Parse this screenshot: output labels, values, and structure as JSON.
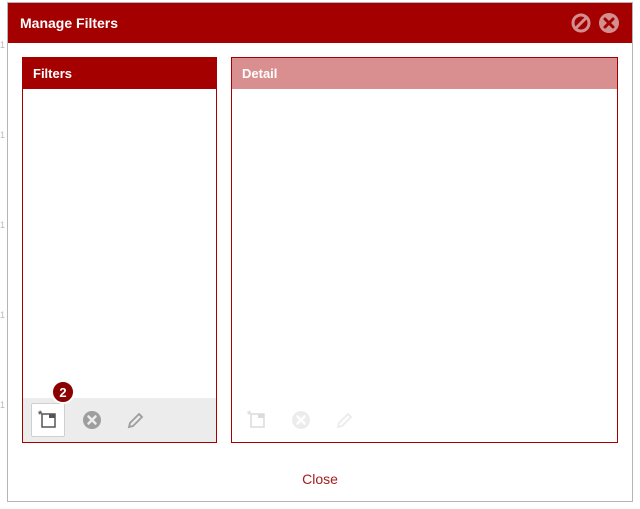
{
  "dialog": {
    "title": "Manage Filters"
  },
  "panels": {
    "filters": {
      "header": "Filters"
    },
    "detail": {
      "header": "Detail"
    }
  },
  "badge": {
    "value": "2"
  },
  "footer": {
    "close_label": "Close"
  }
}
